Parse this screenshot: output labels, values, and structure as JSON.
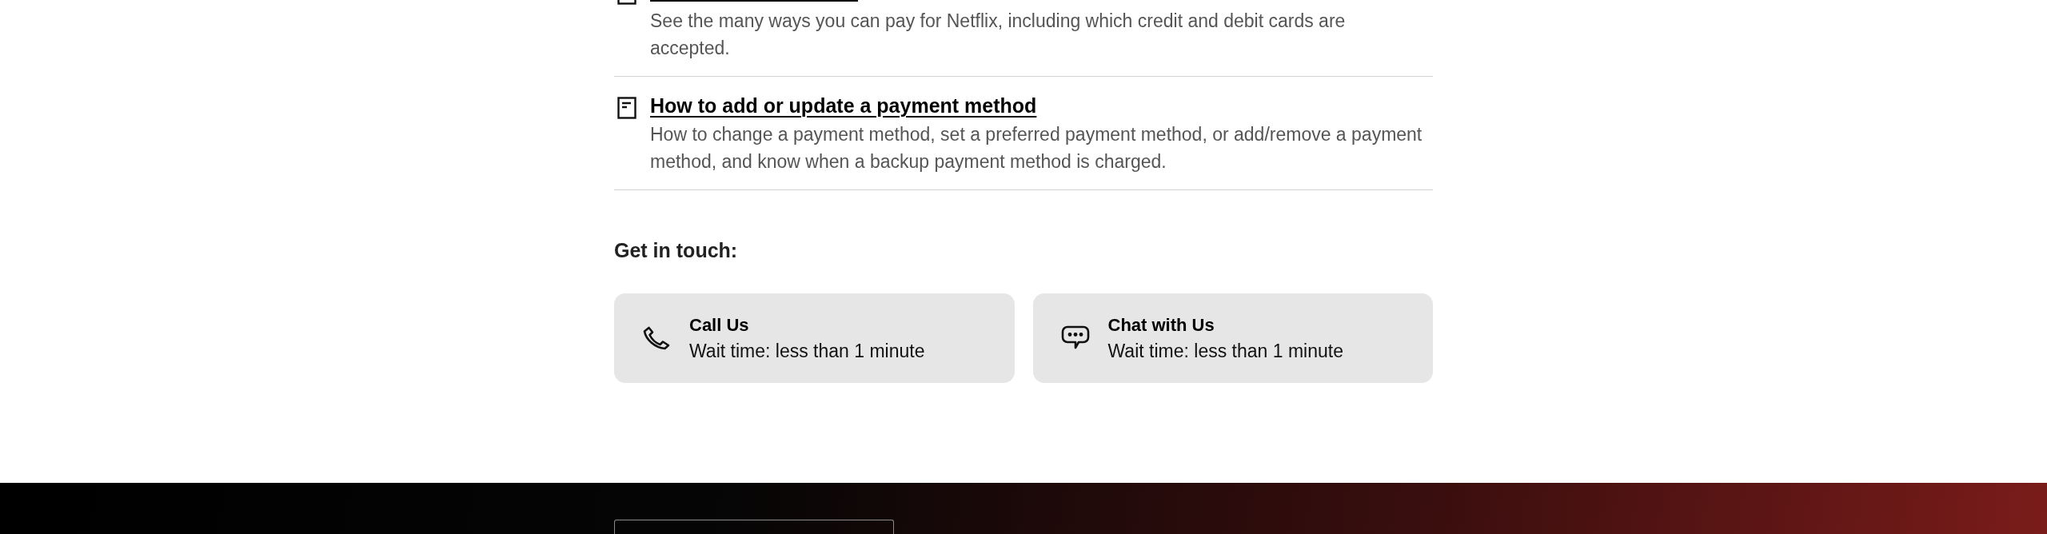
{
  "articles": [
    {
      "description": "See the many ways you can pay for Netflix, including which credit and debit cards are accepted."
    },
    {
      "title": "How to add or update a payment method",
      "description": "How to change a payment method, set a preferred payment method, or add/remove a payment method, and know when a backup payment method is charged."
    }
  ],
  "contact": {
    "heading": "Get in touch:",
    "options": [
      {
        "kind": "call",
        "title": "Call Us",
        "wait_time": "Wait time: less than 1 minute"
      },
      {
        "kind": "chat",
        "title": "Chat with Us",
        "wait_time": "Wait time: less than 1 minute"
      }
    ]
  }
}
